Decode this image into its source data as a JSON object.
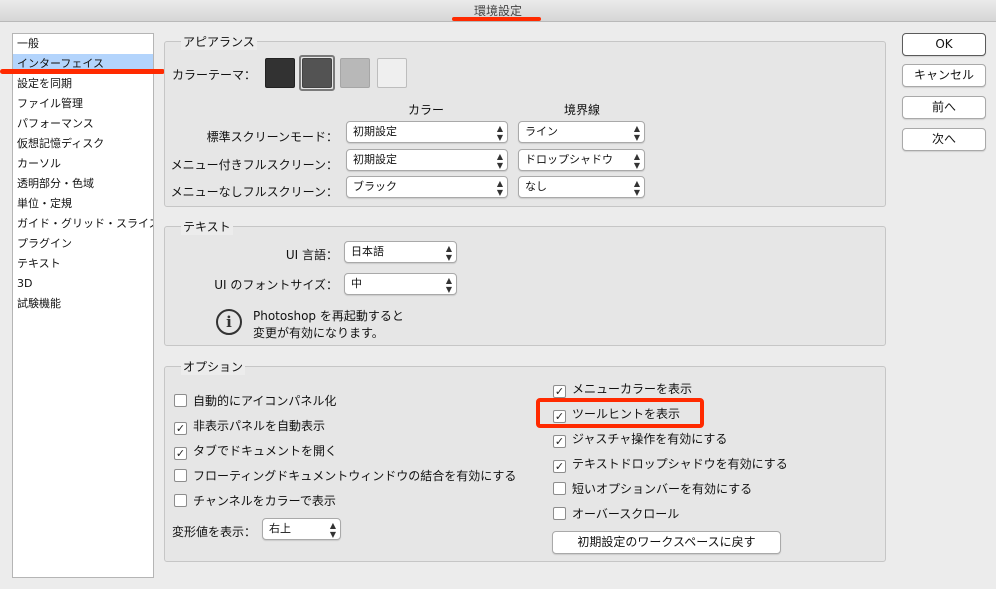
{
  "window": {
    "title": "環境設定"
  },
  "sidebar": {
    "items": [
      {
        "label": "一般"
      },
      {
        "label": "インターフェイス",
        "selected": true
      },
      {
        "label": "設定を同期"
      },
      {
        "label": "ファイル管理"
      },
      {
        "label": "パフォーマンス"
      },
      {
        "label": "仮想記憶ディスク"
      },
      {
        "label": "カーソル"
      },
      {
        "label": "透明部分・色域"
      },
      {
        "label": "単位・定規"
      },
      {
        "label": "ガイド・グリッド・スライス"
      },
      {
        "label": "プラグイン"
      },
      {
        "label": "テキスト"
      },
      {
        "label": "3D"
      },
      {
        "label": "試験機能"
      }
    ]
  },
  "appearance": {
    "title": "アピアランス",
    "color_theme_label": "カラーテーマ：",
    "swatch_colors": [
      "#323232",
      "#535353",
      "#b8b8b8",
      "#efefef"
    ],
    "selected_swatch": 1,
    "col_color": "カラー",
    "col_border": "境界線",
    "rows": [
      {
        "label": "標準スクリーンモード：",
        "color": "初期設定",
        "border": "ライン"
      },
      {
        "label": "メニュー付きフルスクリーン：",
        "color": "初期設定",
        "border": "ドロップシャドウ"
      },
      {
        "label": "メニューなしフルスクリーン：",
        "color": "ブラック",
        "border": "なし"
      }
    ]
  },
  "text_section": {
    "title": "テキスト",
    "ui_language_label": "UI 言語：",
    "ui_language_value": "日本語",
    "ui_font_size_label": "UI のフォントサイズ：",
    "ui_font_size_value": "中",
    "info_line1": "Photoshop を再起動すると",
    "info_line2": "変更が有効になります。"
  },
  "options": {
    "title": "オプション",
    "left": [
      {
        "label": "自動的にアイコンパネル化",
        "checked": false
      },
      {
        "label": "非表示パネルを自動表示",
        "checked": true
      },
      {
        "label": "タブでドキュメントを開く",
        "checked": true
      },
      {
        "label": "フローティングドキュメントウィンドウの結合を有効にする",
        "checked": false
      },
      {
        "label": "チャンネルをカラーで表示",
        "checked": false
      }
    ],
    "transform_label": "変形値を表示：",
    "transform_value": "右上",
    "right": [
      {
        "label": "メニューカラーを表示",
        "checked": true
      },
      {
        "label": "ツールヒントを表示",
        "checked": true
      },
      {
        "label": "ジャスチャ操作を有効にする",
        "checked": true
      },
      {
        "label": "テキストドロップシャドウを有効にする",
        "checked": true
      },
      {
        "label": "短いオプションバーを有効にする",
        "checked": false
      },
      {
        "label": "オーバースクロール",
        "checked": false
      }
    ],
    "restore_button": "初期設定のワークスペースに戻す"
  },
  "buttons": {
    "ok": "OK",
    "cancel": "キャンセル",
    "prev": "前へ",
    "next": "次へ"
  },
  "icons": {
    "select_arrows": "⌃⌄",
    "checkmark": "✓",
    "info": "i"
  },
  "annotation_color": "#ff2a00"
}
